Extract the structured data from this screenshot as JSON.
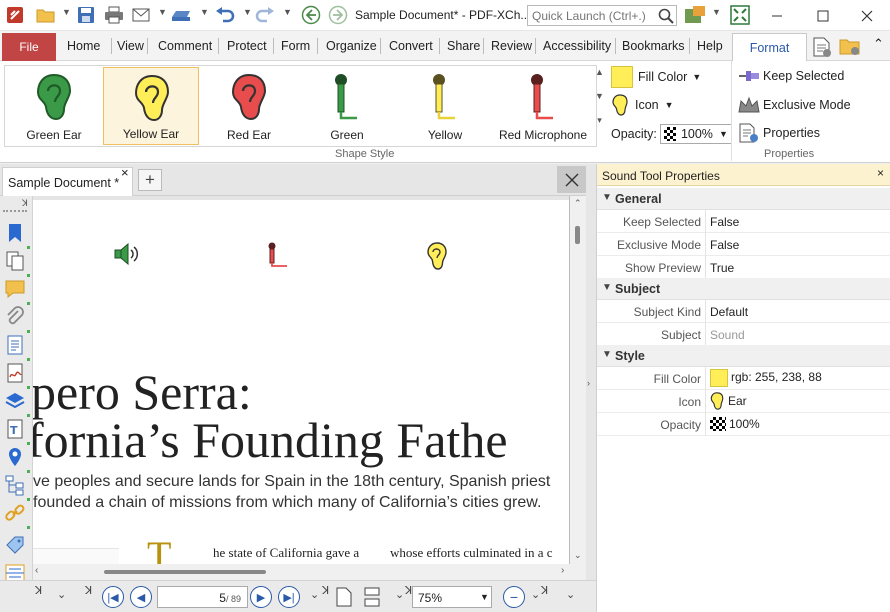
{
  "app": {
    "doc_title": "Sample Document* - PDF-XCh..",
    "quick_launch_placeholder": "Quick Launch (Ctrl+.)"
  },
  "menu": {
    "file": "File",
    "tabs": [
      "Home",
      "View",
      "Comment",
      "Protect",
      "Form",
      "Organize",
      "Convert",
      "Share",
      "Review",
      "Accessibility",
      "Bookmarks",
      "Help"
    ],
    "format": "Format"
  },
  "ribbon": {
    "shape_styles": [
      {
        "label": "Green Ear",
        "color": "#3a9a48"
      },
      {
        "label": "Yellow Ear",
        "color": "#ffee58"
      },
      {
        "label": "Red Ear",
        "color": "#e84c4c"
      },
      {
        "label": "Green",
        "color": "#3a9a48"
      },
      {
        "label": "Yellow",
        "color": "#ffee58"
      },
      {
        "label": "Red Microphone",
        "color": "#e84c4c"
      }
    ],
    "shape_style_group": "Shape Style",
    "fill_color_label": "Fill Color",
    "fill_color": "#ffee58",
    "icon_label": "Icon",
    "opacity_label": "Opacity:",
    "opacity_value": "100%",
    "keep_selected": "Keep Selected",
    "exclusive_mode": "Exclusive Mode",
    "properties": "Properties",
    "properties_group": "Properties"
  },
  "doc_tab": {
    "label": "Sample Document *"
  },
  "document": {
    "heading_line1": "pero Serra:",
    "heading_line2": "fornia’s Founding Fathe",
    "sub_line1": "ve peoples and secure lands for Spain in the 18th century, Spanish priest",
    "sub_line2": "founded a chain of missions from which many of California’s cities grew.",
    "drop_cap": "T",
    "col1_text": "he state of California gave a",
    "col2_text": "whose efforts culminated in a c"
  },
  "status": {
    "page_current": "5",
    "page_total": "/ 89",
    "zoom": "75%"
  },
  "props": {
    "title": "Sound Tool Properties",
    "general": {
      "header": "General",
      "rows": [
        {
          "name": "Keep Selected",
          "value": "False"
        },
        {
          "name": "Exclusive Mode",
          "value": "False"
        },
        {
          "name": "Show Preview",
          "value": "True"
        }
      ]
    },
    "subject": {
      "header": "Subject",
      "rows": [
        {
          "name": "Subject Kind",
          "value": "Default"
        },
        {
          "name": "Subject",
          "value": "Sound"
        }
      ]
    },
    "style": {
      "header": "Style",
      "fill_color_name": "Fill Color",
      "fill_color_value": "rgb: 255, 238, 88",
      "icon_name": "Icon",
      "icon_value": "Ear",
      "opacity_name": "Opacity",
      "opacity_value": "100%"
    }
  }
}
